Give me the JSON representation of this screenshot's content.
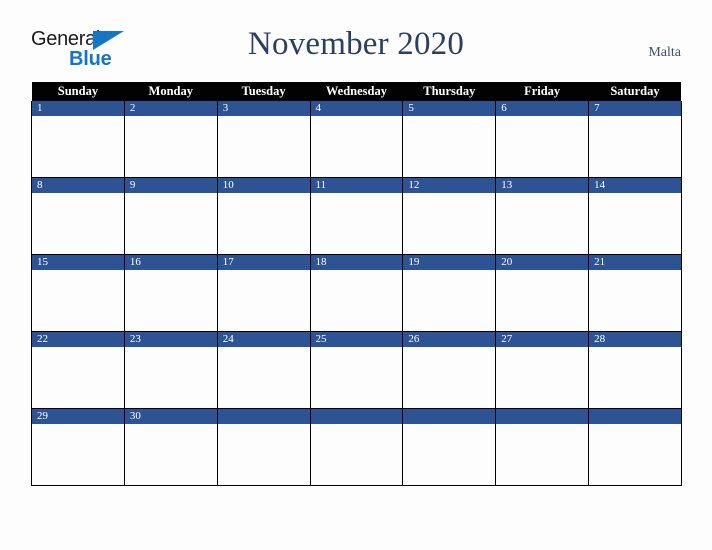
{
  "brand": {
    "name_part1": "General",
    "name_part2": "Blue",
    "triangle_icon": "triangle-icon"
  },
  "header": {
    "title": "November 2020",
    "location": "Malta"
  },
  "colors": {
    "page_background": "#fdfdfd",
    "dow_header_background": "#020203",
    "dow_header_text": "#ffffff",
    "day_band_background": "#2e5395",
    "day_band_text": "#ffffff",
    "title_text": "#2c3f60",
    "location_text": "#3c4f72",
    "brand_blue": "#1576c4",
    "brand_dark": "#1c1c1c",
    "grid_line": "#000000"
  },
  "calendar": {
    "month": "November",
    "year": "2020",
    "day_headers": [
      "Sunday",
      "Monday",
      "Tuesday",
      "Wednesday",
      "Thursday",
      "Friday",
      "Saturday"
    ],
    "weeks": [
      [
        "1",
        "2",
        "3",
        "4",
        "5",
        "6",
        "7"
      ],
      [
        "8",
        "9",
        "10",
        "11",
        "12",
        "13",
        "14"
      ],
      [
        "15",
        "16",
        "17",
        "18",
        "19",
        "20",
        "21"
      ],
      [
        "22",
        "23",
        "24",
        "25",
        "26",
        "27",
        "28"
      ],
      [
        "29",
        "30",
        "",
        "",
        "",
        "",
        ""
      ]
    ]
  }
}
